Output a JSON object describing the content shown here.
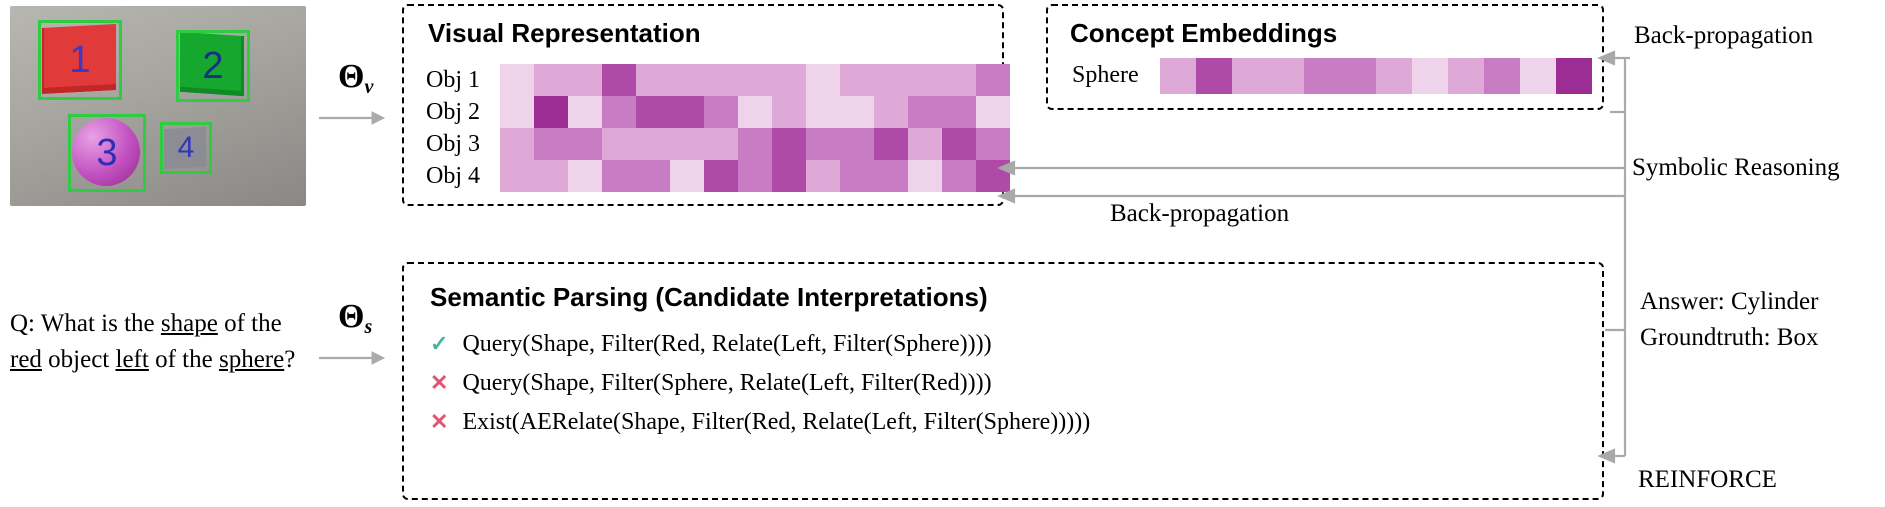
{
  "scene": {
    "objects": [
      {
        "id": "1",
        "label": "1",
        "kind": "red-cube"
      },
      {
        "id": "2",
        "label": "2",
        "kind": "green-cube"
      },
      {
        "id": "3",
        "label": "3",
        "kind": "purple-sphere"
      },
      {
        "id": "4",
        "label": "4",
        "kind": "gray-cube"
      }
    ]
  },
  "question": {
    "prefix": "Q: What is the ",
    "k1": "shape",
    "t1": " of the ",
    "k2": "red",
    "t2": " object ",
    "k3": "left",
    "t3": " of the ",
    "k4": "sphere",
    "suffix": "?"
  },
  "theta": {
    "v": "Θ",
    "vsub": "v",
    "s": "Θ",
    "ssub": "s"
  },
  "visual": {
    "title": "Visual Representation",
    "row_labels": [
      "Obj 1",
      "Obj 2",
      "Obj 3",
      "Obj 4"
    ],
    "palette": [
      "#f8eef6",
      "#eed3ea",
      "#dfa9d7",
      "#c87cc3",
      "#b04aa8",
      "#9b2d94"
    ],
    "rows": [
      [
        1,
        2,
        2,
        4,
        2,
        2,
        2,
        2,
        2,
        1,
        2,
        2,
        2,
        2,
        3
      ],
      [
        1,
        5,
        1,
        3,
        4,
        4,
        3,
        1,
        2,
        1,
        1,
        2,
        3,
        3,
        1
      ],
      [
        2,
        3,
        3,
        2,
        2,
        2,
        2,
        3,
        4,
        3,
        3,
        4,
        2,
        4,
        3
      ],
      [
        2,
        2,
        1,
        3,
        3,
        1,
        4,
        3,
        4,
        2,
        3,
        3,
        1,
        3,
        4
      ]
    ]
  },
  "concept": {
    "title": "Concept Embeddings",
    "label": "Sphere",
    "palette": [
      "#f8eef6",
      "#eed3ea",
      "#dfa9d7",
      "#c87cc3",
      "#b04aa8",
      "#9b2d94"
    ],
    "cells": [
      2,
      4,
      2,
      2,
      3,
      3,
      2,
      1,
      2,
      3,
      1,
      5
    ]
  },
  "parsing": {
    "title": "Semantic Parsing (Candidate Interpretations)",
    "items": [
      {
        "ok": true,
        "text": "Query(Shape, Filter(Red, Relate(Left, Filter(Sphere))))"
      },
      {
        "ok": false,
        "text": "Query(Shape, Filter(Sphere, Relate(Left, Filter(Red))))"
      },
      {
        "ok": false,
        "text": "Exist(AERelate(Shape, Filter(Red, Relate(Left, Filter(Sphere)))))"
      }
    ]
  },
  "right": {
    "backprop1": "Back-propagation",
    "backprop2": "Back-propagation",
    "symbolic": "Symbolic Reasoning",
    "ans_label": "Answer: ",
    "ans_val": "Cylinder",
    "gt_label": "Groundtruth: ",
    "gt_val": "Box",
    "reinforce": "REINFORCE"
  }
}
